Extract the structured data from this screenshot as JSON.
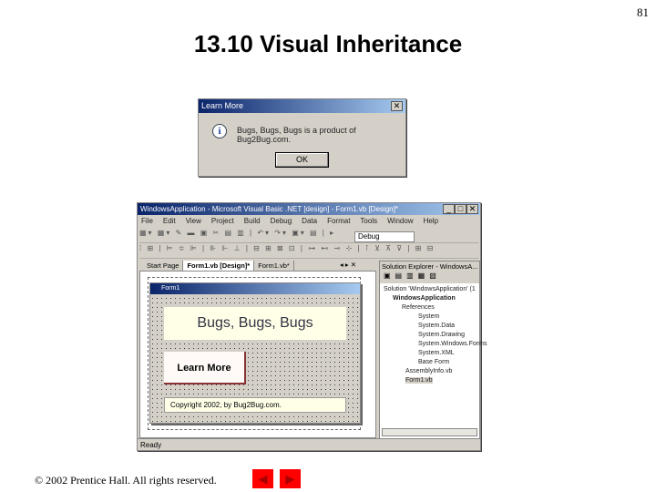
{
  "page_number": "81",
  "title": "13.10  Visual Inheritance",
  "dialog": {
    "title": "Learn More",
    "close": "✕",
    "icon": "i",
    "message": "Bugs, Bugs, Bugs is a product of Bug2Bug.com.",
    "ok": "OK"
  },
  "ide": {
    "title": "WindowsApplication - Microsoft Visual Basic .NET [design] - Form1.vb [Design]*",
    "window_buttons": [
      "_",
      "□",
      "✕"
    ],
    "menu": [
      "File",
      "Edit",
      "View",
      "Project",
      "Build",
      "Debug",
      "Data",
      "Format",
      "Tools",
      "Window",
      "Help"
    ],
    "toolbar1": "▦▾ ▦▾ ✎ ▬ ▣  ✂ ▤ ▥ | ↶▾ ↷▾ ▣▾ ▤ | ▸",
    "config": "Debug",
    "toolbar2": "⁞ ⊞ | ⊨ ≑ ⊫ | ⊪ ⊩ ⊥ | ⊟ ⊞ ⊠ ⊡ | ⊶ ⊷ ⊸ ⊹ | ⊺ ⊻ ⊼ ⊽ | ⊞ ⊟",
    "tabs": [
      "Start Page",
      "Form1.vb [Design]*",
      "Form1.vb*"
    ],
    "tab_controls": "◂ ▸ ✕",
    "form": {
      "title": "Form1",
      "label": "Bugs, Bugs, Bugs",
      "button": "Learn More",
      "copyright": "Copyright 2002, by Bug2Bug.com."
    },
    "solution": {
      "header": "Solution Explorer - WindowsA...  ✕",
      "toolbar": "▣▤▥▦▧",
      "items": [
        "Solution 'WindowsApplication' (1",
        "WindowsApplication",
        "References",
        "System",
        "System.Data",
        "System.Drawing",
        "System.Windows.Forms",
        "System.XML",
        "Base Form",
        "AssemblyInfo.vb",
        "Form1.vb"
      ]
    },
    "status": "Ready"
  },
  "footer": {
    "copyright": "© 2002 Prentice Hall.  All rights reserved.",
    "prev": "◀",
    "next": "▶"
  }
}
